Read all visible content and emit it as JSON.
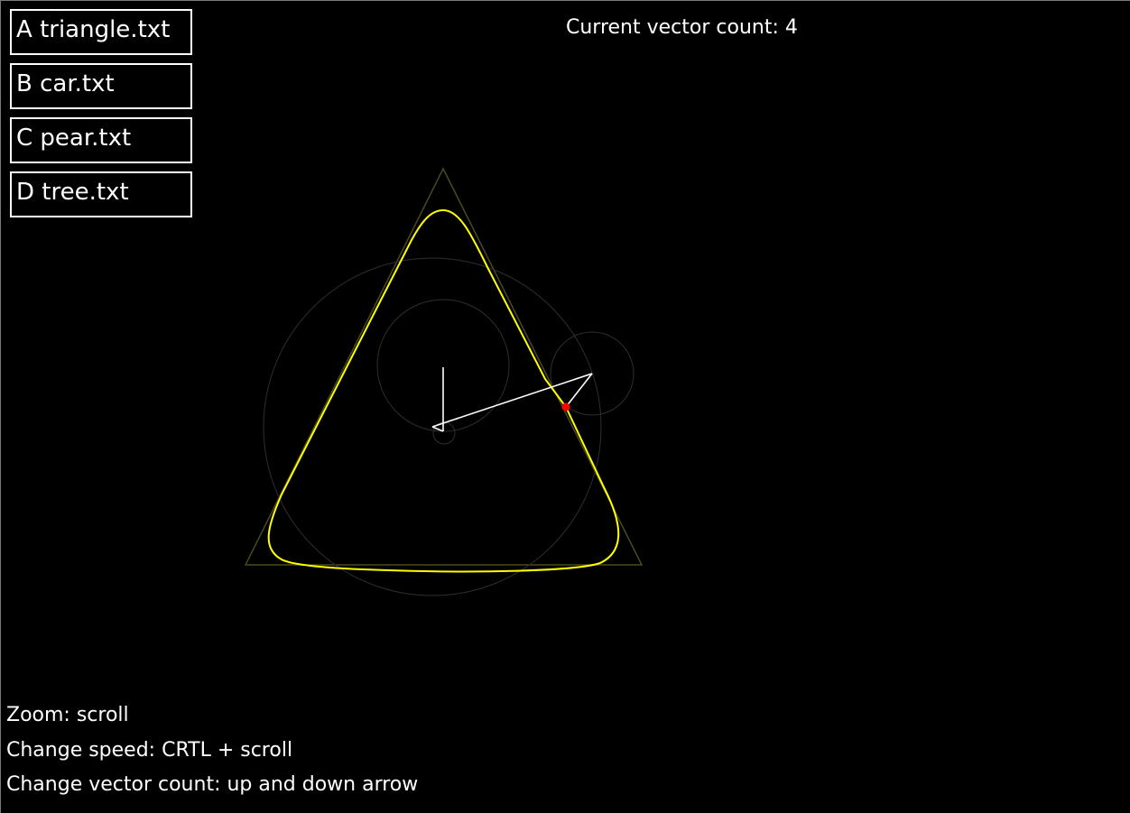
{
  "files": [
    {
      "key": "A",
      "name": "triangle.txt"
    },
    {
      "key": "B",
      "name": "car.txt"
    },
    {
      "key": "C",
      "name": "pear.txt"
    },
    {
      "key": "D",
      "name": "tree.txt"
    }
  ],
  "status": {
    "vector_count_label": "Current vector count: 4",
    "vector_count": 4
  },
  "help": {
    "zoom": "Zoom: scroll",
    "speed": "Change speed: CRTL + scroll",
    "vectors": "Change vector count: up and down arrow"
  },
  "colors": {
    "background": "#000000",
    "text": "#ffffff",
    "target_shape": "#4a4a1c",
    "traced_path": "#ffff00",
    "epicycle_circles": "#2e2e2e",
    "vectors": "#ffffff",
    "pen_point": "#ff0000"
  }
}
